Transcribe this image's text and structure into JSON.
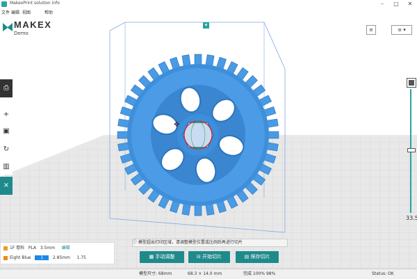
{
  "window": {
    "title": "MakexPrint solution info"
  },
  "menu": {
    "items": [
      "文件",
      "编辑",
      "视图",
      "帮助"
    ]
  },
  "logo": {
    "name": "MAKEX",
    "sub": "Demo"
  },
  "top_right": {
    "btn1": "≡",
    "btn2": "≡ ▾"
  },
  "top_center": {
    "dropdown": "▾"
  },
  "left_tools": {
    "print": "⎙",
    "add": "+",
    "scale": "▣",
    "rotate": "↻",
    "support": "▥",
    "active": "⨯"
  },
  "slider": {
    "value": "33.5"
  },
  "hint": {
    "text": "模型超出打印区域，请调整模型位置或比例后再进行切片"
  },
  "bottom_buttons": {
    "b1": "手动调整",
    "b2": "开始切片",
    "b3": "保存切片"
  },
  "filament": {
    "rows": [
      {
        "label": "1F 卷料",
        "mat": "PLA",
        "value": "3.5mm",
        "action": "编辑",
        "color": "#e6a020"
      },
      {
        "label": "Eight Blue",
        "mat": "1",
        "value": "2.85mm",
        "action": "1.75",
        "color": "#f08a1a"
      }
    ]
  },
  "statusbar": {
    "s1": "模型尺寸: 68mm",
    "s2": "68.3 × 14.0 mm",
    "s3": "完成 100% 98%",
    "s4": "Status: OK"
  }
}
